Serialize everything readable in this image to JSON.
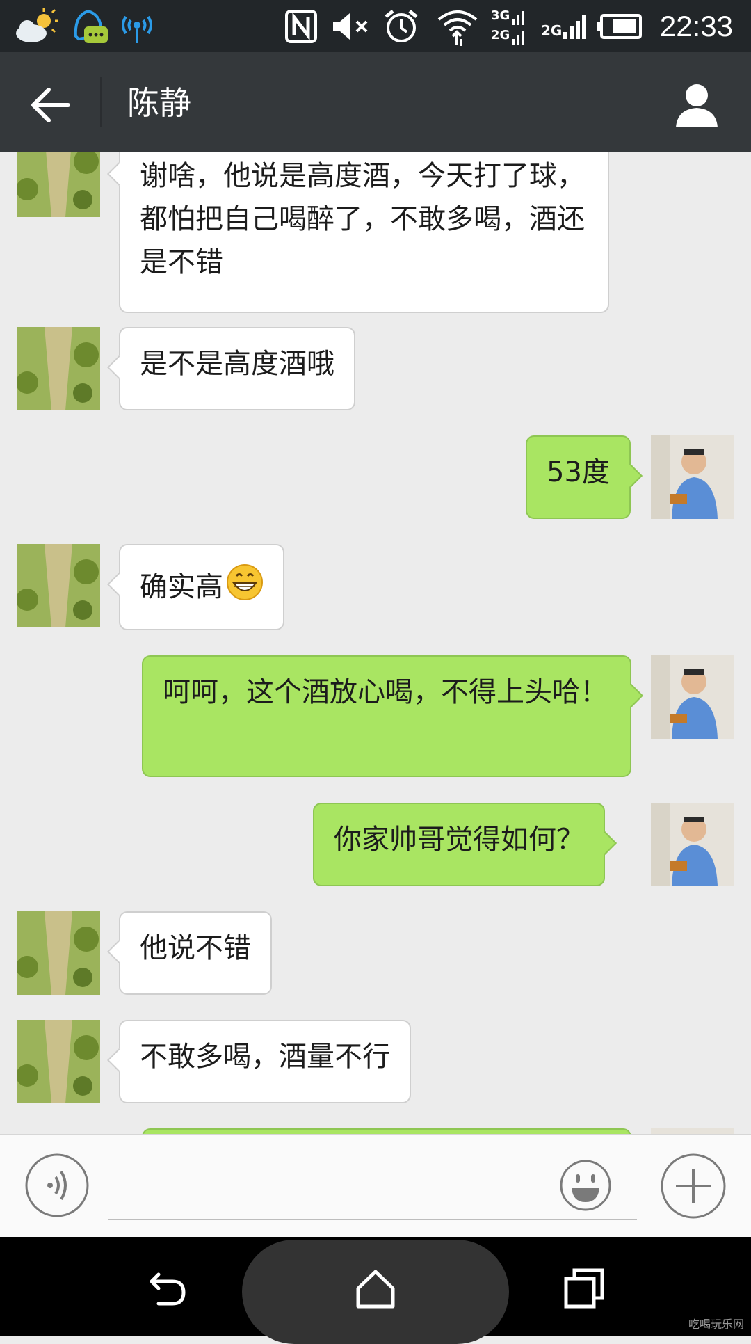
{
  "status_bar": {
    "time": "22:33",
    "signal_3g": "3G",
    "signal_2g_sim1": "2G",
    "signal_2g_sim2": "2G",
    "icons": [
      "weather-icon",
      "qq-icon",
      "wifi-hotspot-icon",
      "nfc-icon",
      "mute-icon",
      "alarm-icon",
      "wifi-icon",
      "signal-icon",
      "battery-icon"
    ]
  },
  "header": {
    "title": "陈静",
    "back_icon": "back-arrow-icon",
    "profile_icon": "person-icon",
    "background": "#34383b"
  },
  "messages": [
    {
      "side": "in",
      "text": "谢啥，他说是高度酒，今天打了球，都怕把自己喝醉了，不敢多喝，酒还是不错"
    },
    {
      "side": "in",
      "text": "是不是高度酒哦"
    },
    {
      "side": "out",
      "text": "53度"
    },
    {
      "side": "in",
      "text": "确实高",
      "emoji": "grin-emoji-icon"
    },
    {
      "side": "out",
      "text": "呵呵，这个酒放心喝，不得上头哈！"
    },
    {
      "side": "out",
      "text": "你家帅哥觉得如何？"
    },
    {
      "side": "in",
      "text": "他说不错"
    },
    {
      "side": "in",
      "text": "不敢多喝，酒量不行"
    },
    {
      "side": "out",
      "text": ""
    }
  ],
  "colors": {
    "incoming_bubble": "#ffffff",
    "outgoing_bubble": "#a9e562",
    "chat_background": "#ececec"
  },
  "input_bar": {
    "placeholder": "",
    "value": "",
    "icons": [
      "voice-icon",
      "emoji-icon",
      "plus-icon"
    ]
  },
  "nav_bar": {
    "icons": [
      "nav-back-icon",
      "nav-home-icon",
      "nav-recent-apps-icon"
    ]
  },
  "watermark": "吃喝玩乐网"
}
